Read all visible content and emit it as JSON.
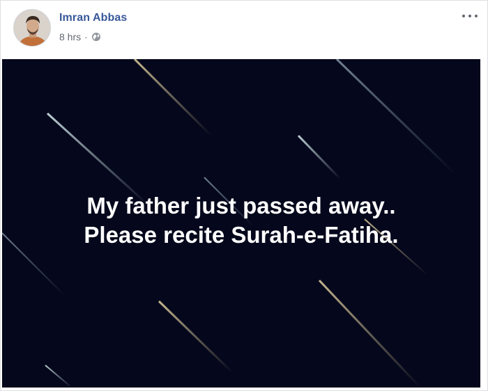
{
  "post": {
    "author_name": "Imran Abbas",
    "timestamp": "8 hrs",
    "separator": "·",
    "privacy_icon": "globe-icon",
    "more_icon": "more-horizontal-icon",
    "caption_line_1": "My father just passed away..",
    "caption_line_2": "Please recite Surah-e-Fatiha."
  },
  "colors": {
    "author_name": "#385898",
    "meta_text": "#616770",
    "image_background": "#05081c",
    "caption_text": "#ffffff"
  }
}
